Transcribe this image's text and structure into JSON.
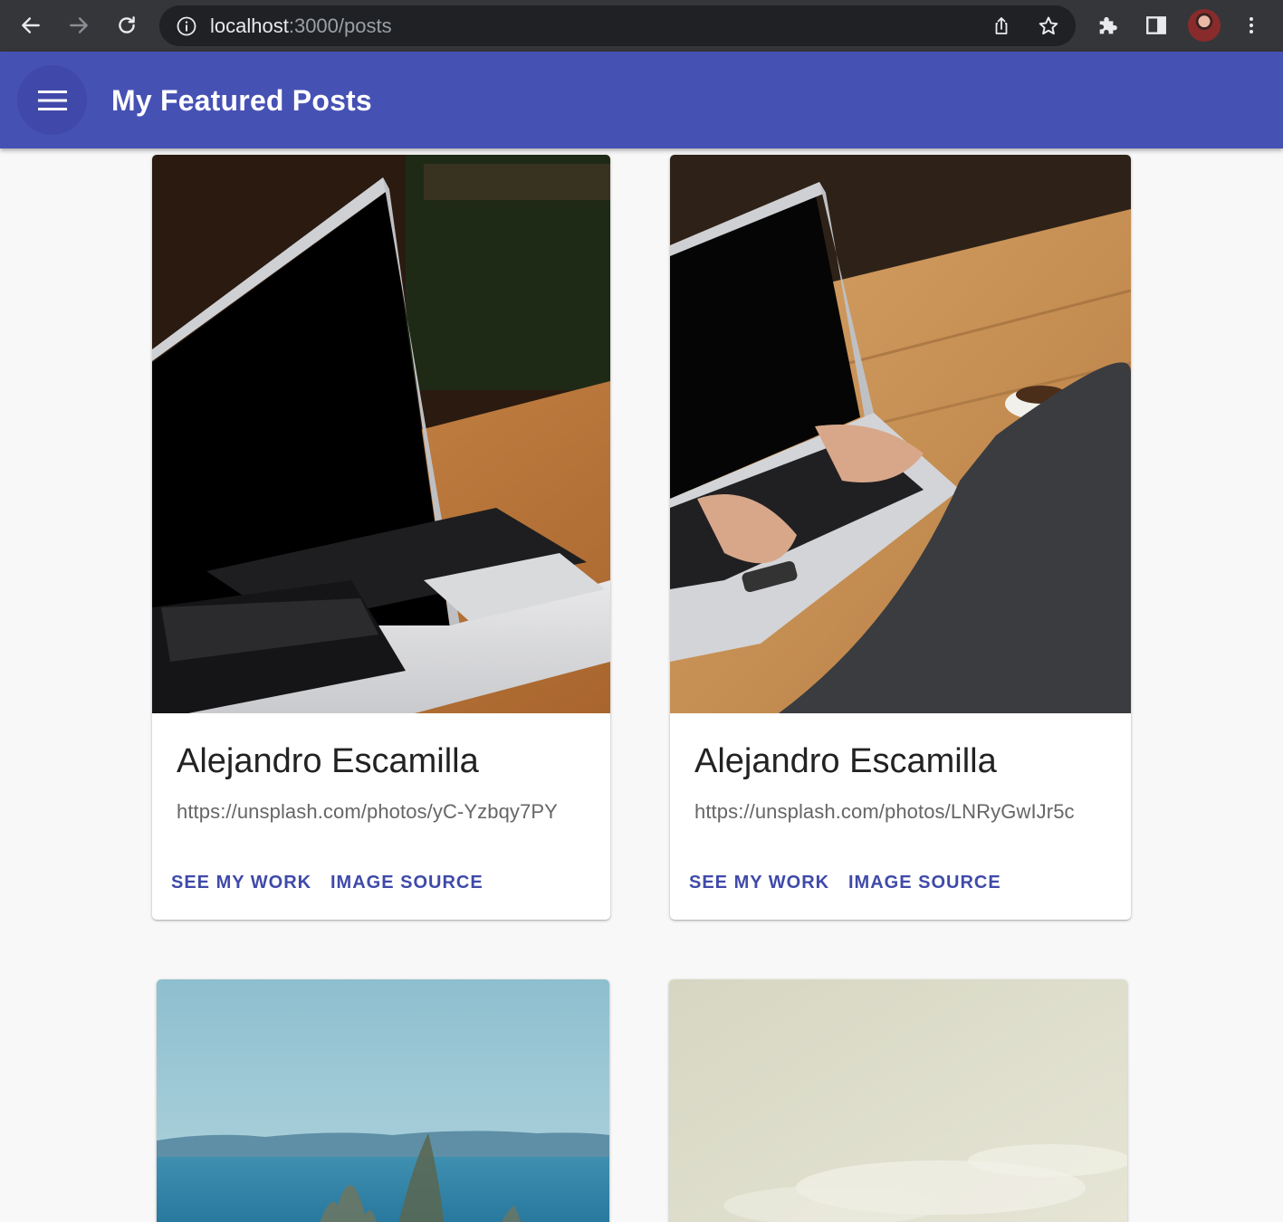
{
  "browser": {
    "url_host": "localhost",
    "url_path": ":3000/posts",
    "icons": [
      "back-arrow-icon",
      "forward-arrow-icon",
      "reload-icon",
      "site-info-icon",
      "share-icon",
      "bookmark-star-icon",
      "extensions-puzzle-icon",
      "side-panel-icon",
      "profile-avatar",
      "more-vertical-icon"
    ]
  },
  "app_bar": {
    "title": "My Featured Posts",
    "menu_icon": "hamburger-menu-icon",
    "color": "#4651b4"
  },
  "posts": [
    {
      "author": "Alejandro Escamilla",
      "source_url": "https://unsplash.com/photos/yC-Yzbqy7PY",
      "actions": [
        "SEE MY WORK",
        "IMAGE SOURCE"
      ],
      "image": "laptop on wooden table with notebook and pen"
    },
    {
      "author": "Alejandro Escamilla",
      "source_url": "https://unsplash.com/photos/LNRyGwIJr5c",
      "actions": [
        "SEE MY WORK",
        "IMAGE SOURCE"
      ],
      "image": "person typing on laptop at wooden table with coffee"
    },
    {
      "image": "sea, distant mountains and plants under blue sky"
    },
    {
      "image": "pale cloudy sky"
    }
  ],
  "colors": {
    "accent": "#3f4aa8",
    "page_background": "#f8f8f8"
  }
}
